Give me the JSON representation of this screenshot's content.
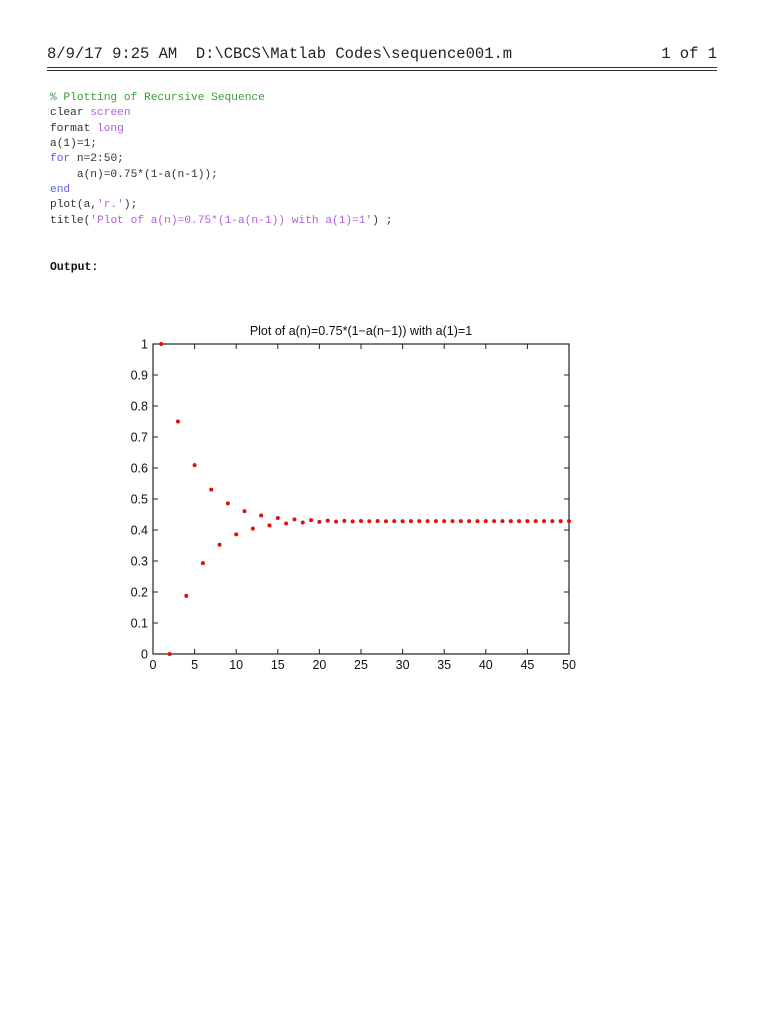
{
  "header": {
    "datetime": "8/9/17 9:25 AM",
    "path": "D:\\CBCS\\Matlab Codes\\sequence001.m",
    "page": "1 of 1"
  },
  "code_lines": [
    [
      {
        "text": "% Plotting of Recursive Sequence",
        "kind": "comment"
      }
    ],
    [
      {
        "text": "clear ",
        "kind": "plain"
      },
      {
        "text": "screen",
        "kind": "string"
      }
    ],
    [
      {
        "text": "format ",
        "kind": "plain"
      },
      {
        "text": "long",
        "kind": "string"
      }
    ],
    [
      {
        "text": "a(1)=1;",
        "kind": "plain"
      }
    ],
    [
      {
        "text": "for",
        "kind": "keyword"
      },
      {
        "text": " n=2:50;",
        "kind": "plain"
      }
    ],
    [
      {
        "text": "    a(n)=0.75*(1-a(n-1));",
        "kind": "plain"
      }
    ],
    [
      {
        "text": "end",
        "kind": "keyword"
      }
    ],
    [
      {
        "text": "plot(a,",
        "kind": "plain"
      },
      {
        "text": "'r.'",
        "kind": "string"
      },
      {
        "text": ");",
        "kind": "plain"
      }
    ],
    [
      {
        "text": "title(",
        "kind": "plain"
      },
      {
        "text": "'Plot of a(n)=0.75*(1-a(n-1)) with a(1)=1'",
        "kind": "string"
      },
      {
        "text": ") ;",
        "kind": "plain"
      }
    ]
  ],
  "output_label": "Output:",
  "chart_data": {
    "type": "scatter",
    "title": "Plot of a(n)=0.75*(1−a(n−1)) with a(1)=1",
    "xlabel": "",
    "ylabel": "",
    "xlim": [
      0,
      50
    ],
    "ylim": [
      0,
      1
    ],
    "xticks": [
      "0",
      "5",
      "10",
      "15",
      "20",
      "25",
      "30",
      "35",
      "40",
      "45",
      "50"
    ],
    "yticks": [
      "0",
      "0.1",
      "0.2",
      "0.3",
      "0.4",
      "0.5",
      "0.6",
      "0.7",
      "0.8",
      "0.9",
      "1"
    ],
    "grid": false,
    "marker_color": "#e01010",
    "x": [
      1,
      2,
      3,
      4,
      5,
      6,
      7,
      8,
      9,
      10,
      11,
      12,
      13,
      14,
      15,
      16,
      17,
      18,
      19,
      20,
      21,
      22,
      23,
      24,
      25,
      26,
      27,
      28,
      29,
      30,
      31,
      32,
      33,
      34,
      35,
      36,
      37,
      38,
      39,
      40,
      41,
      42,
      43,
      44,
      45,
      46,
      47,
      48,
      49,
      50
    ],
    "values": [
      1,
      0,
      0.75,
      0.1875,
      0.6094,
      0.293,
      0.5303,
      0.3523,
      0.4858,
      0.3857,
      0.4608,
      0.4044,
      0.4467,
      0.415,
      0.4388,
      0.4209,
      0.4343,
      0.4243,
      0.4318,
      0.4262,
      0.4304,
      0.4272,
      0.4296,
      0.4278,
      0.4291,
      0.4281,
      0.4289,
      0.4283,
      0.4288,
      0.4284,
      0.4287,
      0.4285,
      0.4286,
      0.4285,
      0.4286,
      0.4285,
      0.4286,
      0.4286,
      0.4286,
      0.4286,
      0.4286,
      0.4286,
      0.4286,
      0.4286,
      0.4286,
      0.4286,
      0.4286,
      0.4286,
      0.4286,
      0.4286
    ]
  }
}
